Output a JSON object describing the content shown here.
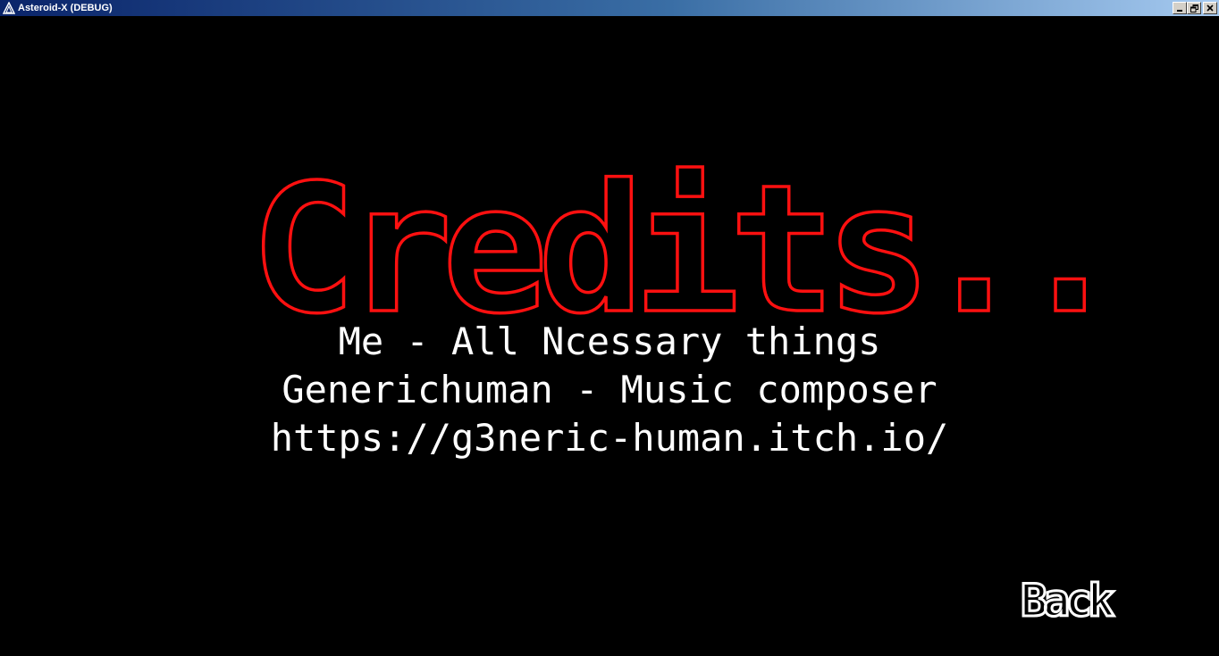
{
  "window": {
    "title": "Asteroid-X (DEBUG)",
    "app_icon": "asteroid-logo-icon",
    "controls": {
      "minimize": "minimize-icon",
      "restore": "restore-icon",
      "close": "close-icon"
    }
  },
  "screen": {
    "heading": "Credits..",
    "lines": [
      "Me - All Ncessary things",
      "Generichuman - Music composer",
      "https://g3neric-human.itch.io/"
    ],
    "back_label": "Back"
  },
  "colors": {
    "background": "#000000",
    "heading_outline": "#ff1010",
    "text": "#ffffff"
  }
}
